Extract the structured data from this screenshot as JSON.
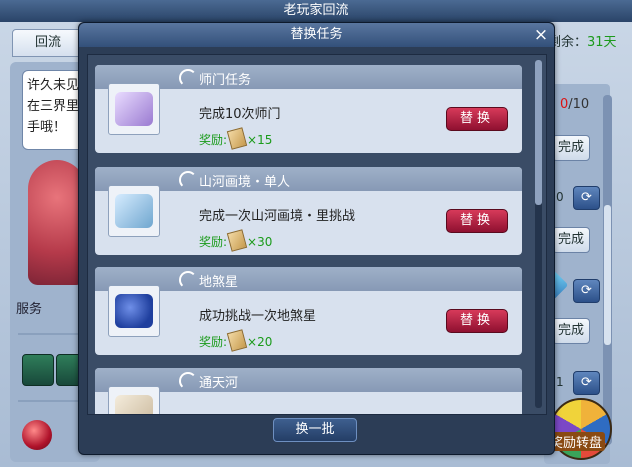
{
  "background": {
    "window_title": "老玩家回流",
    "tab_label": "回流",
    "remaining_label": "剩余：",
    "remaining_days": "31天",
    "speech_text": "许久未见在三界里手哦！",
    "service_label": "服务",
    "progress_count_current": "0",
    "progress_count_total": "/10",
    "done_label": "完成",
    "refresh_icon": "refresh-icon",
    "side_number_1": "0",
    "side_number_2": "1",
    "wheel_label": "奖励转盘"
  },
  "dialog": {
    "title": "替换任务",
    "close_icon": "×",
    "refresh_batch_label": "换一批",
    "reward_label": "奖励:",
    "swap_label": "替换",
    "tasks": [
      {
        "name": "师门任务",
        "desc": "完成10次师门",
        "reward_count": "×15",
        "icon": "scroll-icon",
        "icon_color": "#9a7ad1"
      },
      {
        "name": "山河画境・单人",
        "desc": "完成一次山河画境・里挑战",
        "reward_count": "×30",
        "icon": "shark-icon",
        "icon_color": "#6fa6cf"
      },
      {
        "name": "地煞星",
        "desc": "成功挑战一次地煞星",
        "reward_count": "×20",
        "icon": "star-map-icon",
        "icon_color": "#1f3f9e"
      },
      {
        "name": "通天河",
        "desc": "",
        "reward_count": "",
        "icon": "feather-icon",
        "icon_color": "#c9b79a"
      }
    ]
  }
}
